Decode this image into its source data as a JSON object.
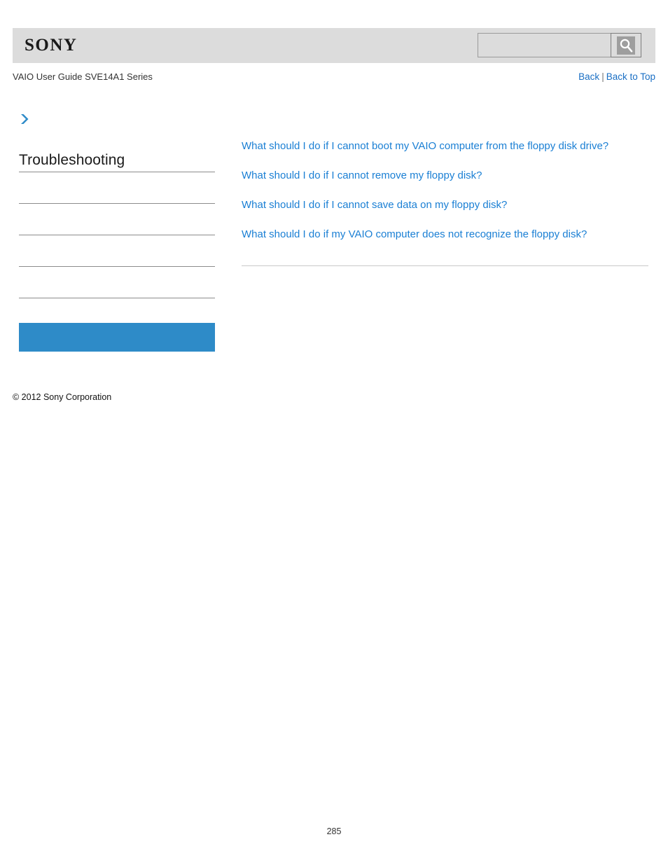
{
  "header": {
    "logo_text": "SONY",
    "guide_title": "VAIO User Guide SVE14A1 Series",
    "nav": {
      "back_label": "Back",
      "separator": "|",
      "back_to_top_label": "Back to Top"
    },
    "search": {
      "value": "",
      "placeholder": "",
      "button_icon": "search-icon"
    }
  },
  "sidebar": {
    "breadcrumb_icon": "chevron-right-icon",
    "title": "Troubleshooting",
    "items": [
      {
        "label": ""
      },
      {
        "label": ""
      },
      {
        "label": ""
      },
      {
        "label": ""
      }
    ],
    "highlight": {
      "label": ""
    },
    "copyright": "© 2012 Sony Corporation"
  },
  "main": {
    "links": [
      {
        "label": "What should I do if I cannot boot my VAIO computer from the floppy disk drive?"
      },
      {
        "label": "What should I do if I cannot remove my floppy disk?"
      },
      {
        "label": "What should I do if I cannot save data on my floppy disk?"
      },
      {
        "label": "What should I do if my VAIO computer does not recognize the floppy disk?"
      }
    ]
  },
  "footer": {
    "page_number": "285"
  },
  "colors": {
    "link_blue": "#1a7fd4",
    "header_band": "#dcdcdc",
    "highlight_blue": "#2e8bc8",
    "rule_gray": "#8c8c8c"
  }
}
